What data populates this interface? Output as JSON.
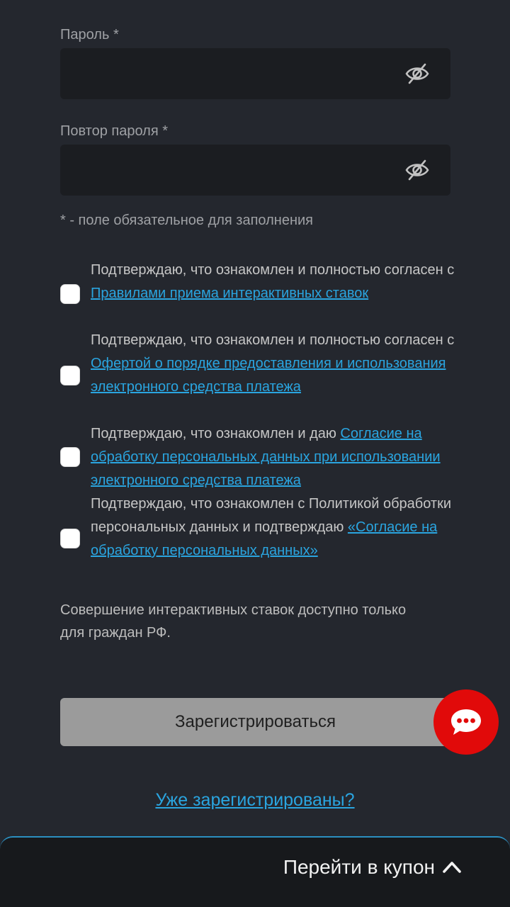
{
  "password": {
    "label": "Пароль *",
    "value": "",
    "placeholder": "",
    "toggle_icon": "eye-off-icon"
  },
  "password_repeat": {
    "label": "Повтор пароля *",
    "value": "",
    "placeholder": "",
    "toggle_icon": "eye-off-icon"
  },
  "required_note": "* - поле обязательное для заполнения",
  "agreements": [
    {
      "text": "Подтверждаю, что ознакомлен и полностью согласен с ",
      "link": "Правилами приема интерактивных ставок",
      "checked": false
    },
    {
      "text": "Подтверждаю, что ознакомлен и полностью согласен с ",
      "link": "Офертой о порядке предоставления и использования электронного средства платежа",
      "checked": false
    },
    {
      "text": "Подтверждаю, что ознакомлен и даю ",
      "link": "Согласие на обработку персональных данных при использовании электронного средства платежа",
      "checked": false
    },
    {
      "text": "Подтверждаю, что ознакомлен с Политикой обработки персональных данных и подтверждаю ",
      "link": "«Согласие на обработку персональных данных»",
      "checked": false
    }
  ],
  "citizen_note": "Совершение интерактивных ставок доступно только для граждан РФ.",
  "register_button": "Зарегистрироваться",
  "chat_icon": "chat-bubble-icon",
  "already_registered": "Уже зарегистрированы?",
  "coupon_bar": {
    "label": "Перейти в купон",
    "icon": "chevron-up-icon"
  },
  "colors": {
    "background": "#24272e",
    "link": "#2aa5e0",
    "chat": "#e10a0a",
    "button": "#9b9b9b"
  }
}
